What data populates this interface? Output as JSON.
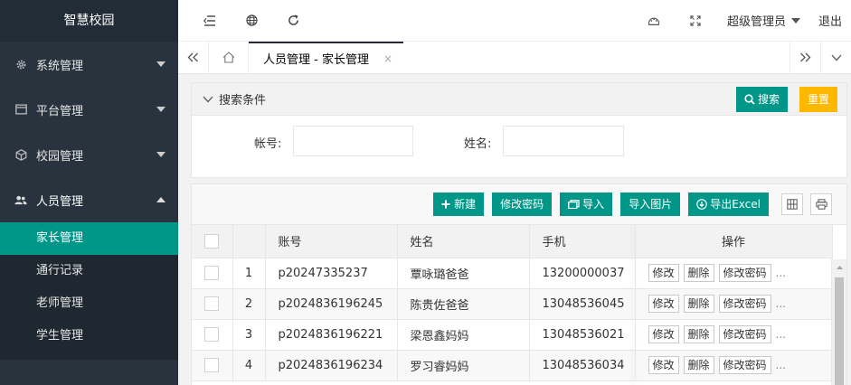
{
  "sidebar": {
    "logo": "智慧校园",
    "groups": [
      {
        "label": "系统管理",
        "icon": "gear-icon"
      },
      {
        "label": "平台管理",
        "icon": "window-icon"
      },
      {
        "label": "校园管理",
        "icon": "cube-icon"
      },
      {
        "label": "人员管理",
        "icon": "users-icon"
      }
    ],
    "sub_items": [
      "家长管理",
      "通行记录",
      "老师管理",
      "学生管理"
    ],
    "active_sub": "家长管理"
  },
  "topbar": {
    "admin_label": "超级管理员",
    "logout_label": "退出"
  },
  "tabs": {
    "active_label": "人员管理 - 家长管理",
    "close_glyph": "×"
  },
  "search": {
    "title": "搜索条件",
    "search_button": "搜索",
    "reset_button": "重置",
    "account_label": "帐号:",
    "account_value": "",
    "name_label": "姓名:",
    "name_value": ""
  },
  "toolbar": {
    "new_button": "新建",
    "change_pwd_button": "修改密码",
    "import_button": "导入",
    "import_images_button": "导入图片",
    "export_button": "导出Excel"
  },
  "table": {
    "headers": {
      "account": "账号",
      "name": "姓名",
      "phone": "手机",
      "actions": "操作"
    },
    "rows": [
      {
        "index": "1",
        "account": "p20247335237",
        "name": "覃咏璐爸爸",
        "phone": "13200000037"
      },
      {
        "index": "2",
        "account": "p2024836196245",
        "name": "陈贵佐爸爸",
        "phone": "13048536045"
      },
      {
        "index": "3",
        "account": "p2024836196221",
        "name": "梁恩鑫妈妈",
        "phone": "13048536021"
      },
      {
        "index": "4",
        "account": "p2024836196234",
        "name": "罗习睿妈妈",
        "phone": "13048536034"
      }
    ],
    "row_actions": {
      "edit": "修改",
      "delete": "删除",
      "change_pwd": "修改密码",
      "more": "..."
    }
  }
}
